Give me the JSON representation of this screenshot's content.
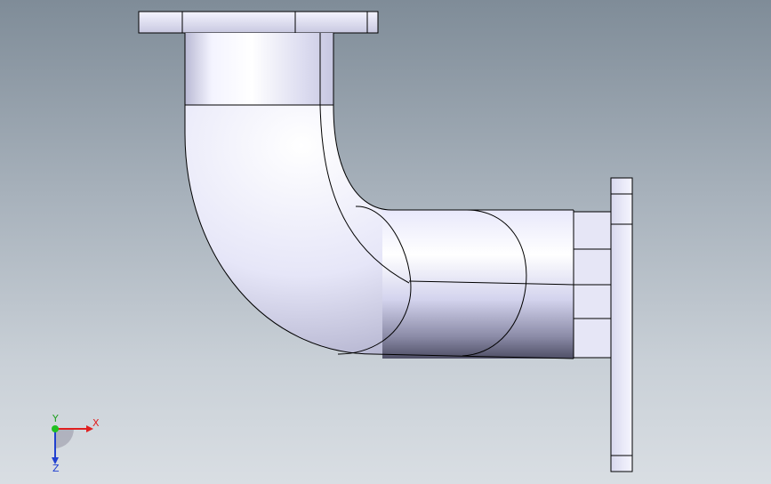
{
  "viewport": {
    "background_top": "#7f8c98",
    "background_bottom": "#d9dee3"
  },
  "model": {
    "name": "pipe-elbow-with-flanges",
    "surface_color": "#dcdcf2",
    "edge_color": "#000000"
  },
  "triad": {
    "x_label": "X",
    "y_label": "Y",
    "z_label": "Z",
    "x_color": "#e02020",
    "y_color": "#20c020",
    "z_color": "#2040d0"
  }
}
